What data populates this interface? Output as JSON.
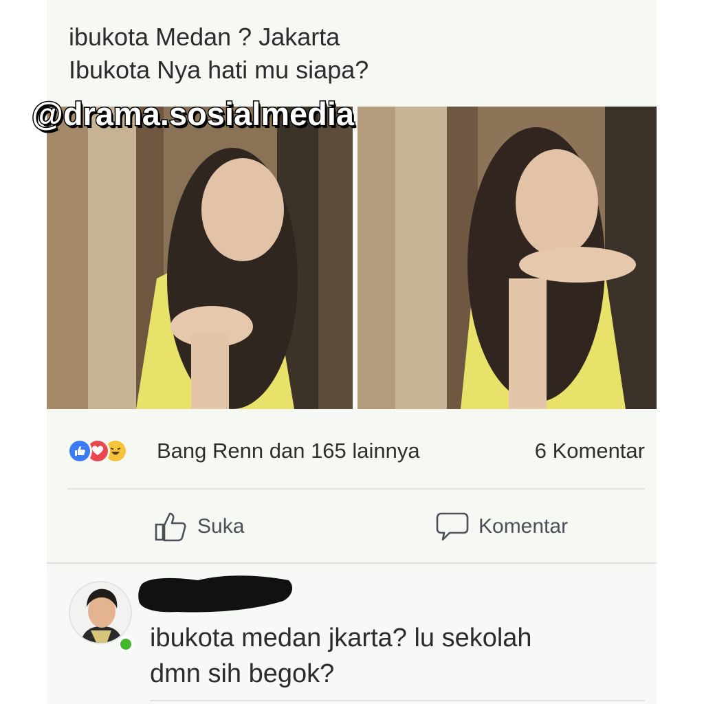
{
  "post": {
    "text_lines": [
      "ibukota Medan ? Jakarta",
      "Ibukota Nya hati mu siapa?"
    ]
  },
  "watermark": "@drama.sosialmedia",
  "reactions": {
    "icons": [
      "like-icon",
      "love-icon",
      "haha-icon"
    ],
    "summary": "Bang Renn dan 165 lainnya",
    "comment_count": "6 Komentar"
  },
  "actions": {
    "like_label": "Suka",
    "comment_label": "Komentar"
  },
  "comment": {
    "text_lines": [
      "ibukota medan jkarta? lu sekolah",
      "dmn sih begok?"
    ],
    "author_redacted": true,
    "author_online": true
  },
  "colors": {
    "like_blue": "#3b7cf5",
    "love_red": "#e8474f",
    "haha_yellow": "#f5c33b",
    "online_green": "#42b72a"
  }
}
